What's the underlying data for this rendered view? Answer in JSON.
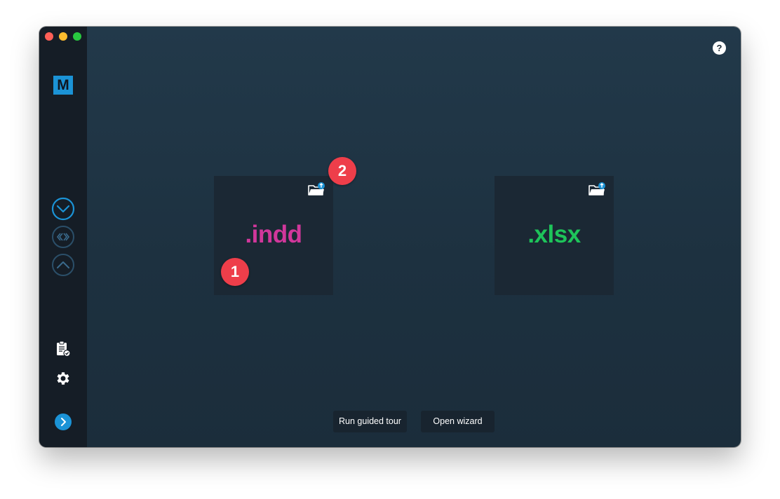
{
  "app": {
    "logo_letter": "M"
  },
  "help": {
    "label": "?"
  },
  "cards": [
    {
      "extension": ".indd",
      "color": "#d1379b",
      "icon": "folder-upload-icon"
    },
    {
      "extension": ".xlsx",
      "color": "#1ec45a",
      "icon": "folder-upload-icon"
    }
  ],
  "badges": {
    "one": "1",
    "two": "2"
  },
  "badge_color": "#ee3e4a",
  "accent_color": "#1b93d6",
  "buttons": {
    "tour_label": "Run guided tour",
    "wizard_label": "Open wizard"
  },
  "sidebar": {
    "icons": [
      "chevron-down-circle-icon",
      "swap-arrows-circle-icon",
      "chevron-up-circle-icon",
      "checklist-icon",
      "gear-icon",
      "chevron-right-icon"
    ]
  }
}
